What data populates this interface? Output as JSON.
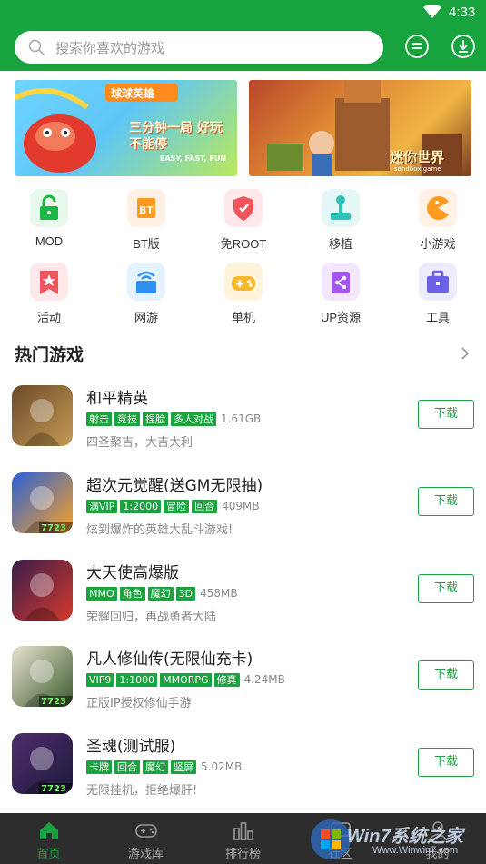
{
  "status": {
    "time": "4:33"
  },
  "search": {
    "placeholder": "搜索你喜欢的游戏"
  },
  "banners": [
    {
      "title": "球球英雄",
      "tagline": "三分钟一局 好玩不能停",
      "sub": "EASY, FAST, FUN"
    },
    {
      "title": "迷你世界",
      "sub": "sandbox game"
    }
  ],
  "categories": [
    {
      "label": "MOD",
      "icon": "lock-icon",
      "bg": "#e8f8ec",
      "fg": "#19b845"
    },
    {
      "label": "BT版",
      "icon": "bt-icon",
      "bg": "#fff1e3",
      "fg": "#ff9a1f"
    },
    {
      "label": "免ROOT",
      "icon": "shield-icon",
      "bg": "#ffe8ea",
      "fg": "#f2545b"
    },
    {
      "label": "移植",
      "icon": "joystick-icon",
      "bg": "#e2f7f6",
      "fg": "#2cc3b9"
    },
    {
      "label": "小游戏",
      "icon": "pacman-icon",
      "bg": "#fff1e3",
      "fg": "#ff9a1f"
    },
    {
      "label": "活动",
      "icon": "star-bookmark-icon",
      "bg": "#ffe8ea",
      "fg": "#f2545b"
    },
    {
      "label": "网游",
      "icon": "network-icon",
      "bg": "#e5f2ff",
      "fg": "#2e8ff2"
    },
    {
      "label": "单机",
      "icon": "gamepad-icon",
      "bg": "#fff3dc",
      "fg": "#f7b92a"
    },
    {
      "label": "UP资源",
      "icon": "share-icon",
      "bg": "#f2e7ff",
      "fg": "#a455ee"
    },
    {
      "label": "工具",
      "icon": "toolbox-icon",
      "bg": "#ecebff",
      "fg": "#6c62ea"
    }
  ],
  "section": {
    "title": "热门游戏"
  },
  "games": [
    {
      "name": "和平精英",
      "tags": [
        "射击",
        "竞技",
        "捏脸",
        "多人对战"
      ],
      "size": "1.61GB",
      "desc": "四圣聚吉，大吉大利",
      "btn": "下载",
      "badge": "",
      "icon_colors": [
        "#6b4a2a",
        "#c59a55"
      ]
    },
    {
      "name": "超次元觉醒(送GM无限抽)",
      "tags": [
        "满VIP",
        "1:2000",
        "冒险",
        "回合"
      ],
      "size": "409MB",
      "desc": "炫到爆炸的英雄大乱斗游戏!",
      "btn": "下载",
      "badge": "7723",
      "icon_colors": [
        "#2a60d8",
        "#f8a125"
      ]
    },
    {
      "name": "大天使高爆版",
      "tags": [
        "MMO",
        "角色",
        "魔幻",
        "3D"
      ],
      "size": "458MB",
      "desc": "荣耀回归，再战勇者大陆",
      "btn": "下载",
      "badge": "",
      "icon_colors": [
        "#3a1c4c",
        "#d33a2a"
      ]
    },
    {
      "name": "凡人修仙传(无限仙充卡)",
      "tags": [
        "VIP9",
        "1:1000",
        "MMORPG",
        "修真"
      ],
      "size": "4.24MB",
      "desc": "正版IP授权修仙手游",
      "btn": "下载",
      "badge": "7723",
      "icon_colors": [
        "#e9e3cf",
        "#3a5a2c"
      ]
    },
    {
      "name": "圣魂(测试服)",
      "tags": [
        "卡牌",
        "回合",
        "魔幻",
        "竖屏"
      ],
      "size": "5.02MB",
      "desc": "无限挂机，拒绝爆肝!",
      "btn": "下载",
      "badge": "7723",
      "icon_colors": [
        "#4e2d6e",
        "#1e1a3a"
      ]
    }
  ],
  "nav": [
    {
      "label": "首页",
      "icon": "home-icon",
      "active": true
    },
    {
      "label": "游戏库",
      "icon": "gamepad-icon",
      "active": false
    },
    {
      "label": "排行榜",
      "icon": "ranking-icon",
      "active": false
    },
    {
      "label": "社区",
      "icon": "community-icon",
      "active": false
    },
    {
      "label": "我的",
      "icon": "user-icon",
      "active": false
    }
  ],
  "watermark": {
    "text": "Win7系统之家",
    "url": "Www.Winwin7.com"
  },
  "colors": {
    "accent": "#17a33d",
    "nav_bg": "#2d2d2d"
  }
}
